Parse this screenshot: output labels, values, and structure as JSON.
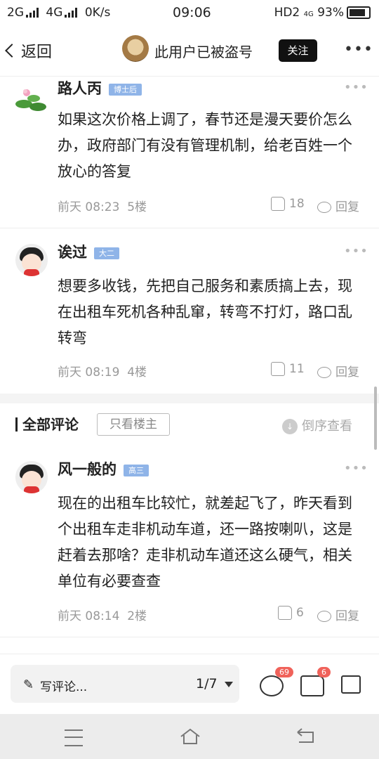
{
  "status_bar": {
    "network1": "2G",
    "network2": "4G",
    "speed": "0K/s",
    "time": "09:06",
    "hd": "HD2",
    "net3": "4G",
    "battery": "93%"
  },
  "header": {
    "back_label": "返回",
    "title": "此用户已被盗号",
    "follow_label": "关注",
    "more": "•••"
  },
  "comments_top": [
    {
      "user": "路人丙",
      "badge": "博士后",
      "text": "如果这次价格上调了，春节还是漫天要价怎么办，政府部门有没有管理机制，给老百姓一个放心的答复",
      "time": "前天 08:23",
      "floor": "5楼",
      "likes": "18",
      "reply": "回复",
      "avatar": "lotus"
    },
    {
      "user": "诶过",
      "badge": "大二",
      "text": "想要多收钱，先把自己服务和素质搞上去，现在出租车死机各种乱窜，转弯不打灯，路口乱转弯",
      "time": "前天 08:19",
      "floor": "4楼",
      "likes": "11",
      "reply": "回复",
      "avatar": "cartoon-boy"
    }
  ],
  "section": {
    "title": "全部评论",
    "only_owner": "只看楼主",
    "sort_label": "倒序查看"
  },
  "comments_all": [
    {
      "user": "风一般的",
      "badge": "高三",
      "text": "现在的出租车比较忙，就差起飞了，昨天看到个出租车走非机动车道，还一路按喇叭，这是赶着去那啥？走非机动车道还这么硬气，相关单位有必要查查",
      "time": "前天 08:14",
      "floor": "2楼",
      "likes": "6",
      "reply": "回复",
      "avatar": "cartoon-boy"
    }
  ],
  "bottom_bar": {
    "write_placeholder": "写评论...",
    "page": "1/7",
    "comment_count": "69",
    "like_count": "6"
  },
  "icons": [
    "back-chevron-icon",
    "more-icon",
    "thumb-up-icon",
    "reply-bubble-icon",
    "sort-icon",
    "pencil-icon",
    "comment-icon",
    "like-icon",
    "share-icon",
    "menu-icon",
    "home-icon",
    "back-nav-icon"
  ]
}
